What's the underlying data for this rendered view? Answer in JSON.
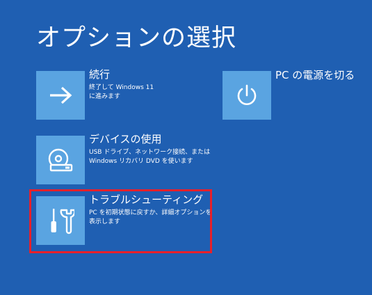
{
  "title": "オプションの選択",
  "options": {
    "continue": {
      "title": "続行",
      "desc_line1": "終了して Windows 11",
      "desc_line2": "に進みます",
      "icon": "arrow-right-icon"
    },
    "use_device": {
      "title": "デバイスの使用",
      "desc_line1": "USB ドライブ、ネットワーク接続、または",
      "desc_line2": "Windows リカバリ DVD を使います",
      "icon": "disc-drive-icon"
    },
    "troubleshoot": {
      "title": "トラブルシューティング",
      "desc_line1": "PC を初期状態に戻すか、詳細オプションを",
      "desc_line2": "表示します",
      "icon": "tools-icon"
    },
    "power_off": {
      "title": "PC の電源を切る",
      "icon": "power-icon"
    }
  },
  "colors": {
    "background": "#1f5fb2",
    "tile": "#5aa4e1",
    "highlight": "#e8202a"
  }
}
